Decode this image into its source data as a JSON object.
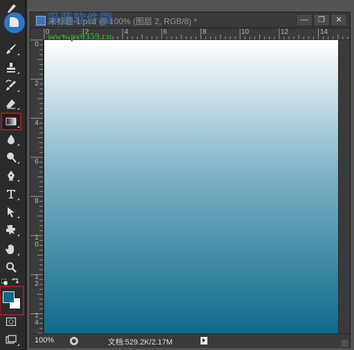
{
  "document": {
    "title": "未标题-1.psd @ 100% (图层 2, RGB/8) *",
    "window_buttons": {
      "minimize": "—",
      "restore": "❐",
      "close": "✕"
    }
  },
  "ruler": {
    "top_labels": [
      "0",
      "2",
      "4",
      "6",
      "8",
      "10",
      "12",
      "14"
    ],
    "left_labels": [
      "0",
      "2",
      "4",
      "6",
      "8",
      "10",
      "12",
      "14"
    ]
  },
  "statusbar": {
    "zoom": "100%",
    "docinfo": "文档:529.2K/2.17M"
  },
  "watermark": {
    "title": "采蓝软件园",
    "url": "www.pc0359.cn"
  },
  "swatches": {
    "foreground": "#0f6a8c",
    "background": "#ffffff"
  },
  "gradient": {
    "top_color": "#ffffff",
    "bottom_color": "#0f6a8c"
  },
  "tools": [
    "eyedropper-icon",
    "brush-icon",
    "stamp-icon",
    "history-brush-icon",
    "eraser-icon",
    "gradient-icon",
    "blur-icon",
    "dodge-icon",
    "pen-icon",
    "type-icon",
    "path-select-icon",
    "shape-icon",
    "hand-icon",
    "zoom-icon",
    "quick-mask-icon",
    "screen-mode-icon"
  ]
}
